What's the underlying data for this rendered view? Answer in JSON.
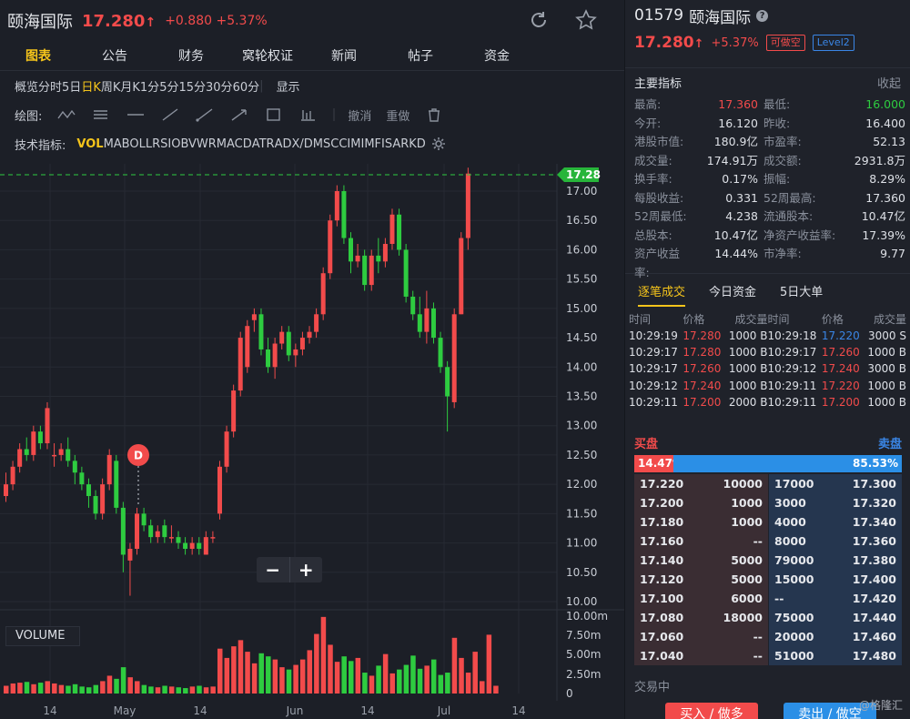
{
  "header": {
    "name": "颐海国际",
    "price": "17.280",
    "arrow": "↑",
    "change": "+0.880",
    "change_pct": "+5.37%"
  },
  "tabs": [
    "图表",
    "公告",
    "财务",
    "窝轮权证",
    "新闻",
    "帖子",
    "资金"
  ],
  "periods": [
    "概览",
    "分时",
    "5日",
    "日K",
    "周K",
    "月K",
    "1分",
    "5分",
    "15分",
    "30分",
    "60分"
  ],
  "display_label": "显示",
  "draw": {
    "label": "绘图:",
    "undo": "撤消",
    "redo": "重做"
  },
  "indicators_label": "技术指标:",
  "indicators": [
    "VOL",
    "MA",
    "BOLL",
    "RSI",
    "OBV",
    "WR",
    "MACD",
    "ATR",
    "ADX/DMS",
    "CCI",
    "MI",
    "MFI",
    "SAR",
    "KD"
  ],
  "volume_label": "VOLUME",
  "marker_label": "D",
  "chart_data": {
    "type": "candlestick",
    "last_price_tag": "17.28",
    "price_ticks": [
      "17.00",
      "16.50",
      "16.00",
      "15.50",
      "15.00",
      "14.50",
      "14.00",
      "13.50",
      "13.00",
      "12.50",
      "12.00",
      "11.50",
      "11.00",
      "10.50",
      "10.00"
    ],
    "volume_ticks": [
      "10.00m",
      "7.50m",
      "5.00m",
      "2.50m",
      "0"
    ],
    "x_ticks": [
      "14",
      "May",
      "14",
      "Jun",
      "14",
      "Jul",
      "14"
    ],
    "candles": [
      [
        11.8,
        12.0,
        12.2,
        11.7
      ],
      [
        12.0,
        12.3,
        12.4,
        11.9
      ],
      [
        12.3,
        12.6,
        12.7,
        12.2
      ],
      [
        12.6,
        12.5,
        12.8,
        12.4
      ],
      [
        12.5,
        12.9,
        13.0,
        12.4
      ],
      [
        12.9,
        12.7,
        13.0,
        12.6
      ],
      [
        12.7,
        13.3,
        13.4,
        12.6
      ],
      [
        12.5,
        12.5,
        12.7,
        12.3
      ],
      [
        12.5,
        12.6,
        12.7,
        12.4
      ],
      [
        12.6,
        12.4,
        12.8,
        12.3
      ],
      [
        12.4,
        12.2,
        12.5,
        12.0
      ],
      [
        12.2,
        12.0,
        12.3,
        11.9
      ],
      [
        12.0,
        11.8,
        12.1,
        11.6
      ],
      [
        11.8,
        11.5,
        11.9,
        11.4
      ],
      [
        11.5,
        12.0,
        12.1,
        11.4
      ],
      [
        12.0,
        12.5,
        12.6,
        11.9
      ],
      [
        12.4,
        11.6,
        12.5,
        11.5
      ],
      [
        11.6,
        10.8,
        11.7,
        10.5
      ],
      [
        10.7,
        10.9,
        11.0,
        10.1
      ],
      [
        10.9,
        11.5,
        11.6,
        10.8
      ],
      [
        11.5,
        11.3,
        11.6,
        11.2
      ],
      [
        11.3,
        11.1,
        11.4,
        11.0
      ],
      [
        11.1,
        11.2,
        11.3,
        11.0
      ],
      [
        11.3,
        11.1,
        11.4,
        11.0
      ],
      [
        11.1,
        11.1,
        11.3,
        11.0
      ],
      [
        11.1,
        11.0,
        11.2,
        10.9
      ],
      [
        11.0,
        10.9,
        11.1,
        10.8
      ],
      [
        10.9,
        11.0,
        11.1,
        10.8
      ],
      [
        11.0,
        10.9,
        11.1,
        10.8
      ],
      [
        10.8,
        11.1,
        11.2,
        10.8
      ],
      [
        11.1,
        11.1,
        11.2,
        11.0
      ],
      [
        11.5,
        12.3,
        12.4,
        11.4
      ],
      [
        12.3,
        12.9,
        13.0,
        12.2
      ],
      [
        12.9,
        13.6,
        13.7,
        12.8
      ],
      [
        13.6,
        14.5,
        14.6,
        13.5
      ],
      [
        14.0,
        14.7,
        14.8,
        13.9
      ],
      [
        14.8,
        14.9,
        15.0,
        14.6
      ],
      [
        14.9,
        14.3,
        15.0,
        14.2
      ],
      [
        14.3,
        14.0,
        14.5,
        13.9
      ],
      [
        14.0,
        14.4,
        14.5,
        13.8
      ],
      [
        14.4,
        14.6,
        14.7,
        14.3
      ],
      [
        14.6,
        14.2,
        14.7,
        14.1
      ],
      [
        14.2,
        14.3,
        14.4,
        14.0
      ],
      [
        14.3,
        14.5,
        14.6,
        14.2
      ],
      [
        14.5,
        14.6,
        14.7,
        14.4
      ],
      [
        14.6,
        14.9,
        15.0,
        14.5
      ],
      [
        14.9,
        15.6,
        15.7,
        14.8
      ],
      [
        15.6,
        16.5,
        16.6,
        15.5
      ],
      [
        16.5,
        17.0,
        17.1,
        16.4
      ],
      [
        17.0,
        16.2,
        17.1,
        16.1
      ],
      [
        16.2,
        15.8,
        16.3,
        15.6
      ],
      [
        15.8,
        15.9,
        16.1,
        15.7
      ],
      [
        15.9,
        15.4,
        16.0,
        15.3
      ],
      [
        15.4,
        15.9,
        16.0,
        15.3
      ],
      [
        15.9,
        15.8,
        16.2,
        15.6
      ],
      [
        15.8,
        16.1,
        16.2,
        15.7
      ],
      [
        16.1,
        16.6,
        16.7,
        16.0
      ],
      [
        16.6,
        16.0,
        16.7,
        15.9
      ],
      [
        16.0,
        15.2,
        16.1,
        15.1
      ],
      [
        15.2,
        14.9,
        15.3,
        14.8
      ],
      [
        14.9,
        14.6,
        15.2,
        14.5
      ],
      [
        14.6,
        15.0,
        15.3,
        14.4
      ],
      [
        15.0,
        14.5,
        15.1,
        14.4
      ],
      [
        14.5,
        14.0,
        14.6,
        13.9
      ],
      [
        14.0,
        13.5,
        14.1,
        12.9
      ],
      [
        13.4,
        14.9,
        15.0,
        13.3
      ],
      [
        14.9,
        16.2,
        16.3,
        14.9
      ],
      [
        16.2,
        17.3,
        17.4,
        16.0
      ]
    ],
    "volumes": [
      1.0,
      1.3,
      1.4,
      1.5,
      1.2,
      1.4,
      1.6,
      1.3,
      1.1,
      1.0,
      1.2,
      0.9,
      0.8,
      1.1,
      1.6,
      2.3,
      1.9,
      3.4,
      2.1,
      1.6,
      1.1,
      0.9,
      0.8,
      1.0,
      0.9,
      0.8,
      0.7,
      0.9,
      1.0,
      0.8,
      0.9,
      5.8,
      4.6,
      6.1,
      6.9,
      5.4,
      3.9,
      5.2,
      4.8,
      4.4,
      3.4,
      3.1,
      3.7,
      4.4,
      5.6,
      7.7,
      9.9,
      6.3,
      4.1,
      4.8,
      4.2,
      4.6,
      2.7,
      2.3,
      3.6,
      5.1,
      2.6,
      3.1,
      3.7,
      4.9,
      3.2,
      3.6,
      4.4,
      2.4,
      2.7,
      7.2,
      4.6,
      2.7,
      5.4,
      1.6,
      7.6,
      1.0
    ]
  },
  "right": {
    "code": "01579",
    "name": "颐海国际",
    "price": "17.280",
    "arrow": "↑",
    "change_pct": "+5.37%",
    "badge_short": "可做空",
    "badge_level": "Level2",
    "metrics_title": "主要指标",
    "metrics_collapse": "收起",
    "metrics": [
      {
        "k": "最高:",
        "v": "17.360",
        "k2": "最低:",
        "v2": "16.000"
      },
      {
        "k": "今开:",
        "v": "16.120",
        "k2": "昨收:",
        "v2": "16.400"
      },
      {
        "k": "港股市值:",
        "v": "180.9亿",
        "k2": "市盈率:",
        "v2": "52.13"
      },
      {
        "k": "成交量:",
        "v": "174.91万",
        "k2": "成交额:",
        "v2": "2931.8万"
      },
      {
        "k": "换手率:",
        "v": "0.17%",
        "k2": "振幅:",
        "v2": "8.29%"
      },
      {
        "k": "每股收益:",
        "v": "0.331",
        "k2": "52周最高:",
        "v2": "17.360"
      },
      {
        "k": "52周最低:",
        "v": "4.238",
        "k2": "流通股本:",
        "v2": "10.47亿"
      },
      {
        "k": "总股本:",
        "v": "10.47亿",
        "k2": "净资产收益率:",
        "v2": "17.39%"
      },
      {
        "k": "资产收益率:",
        "v": "14.44%",
        "k2": "市净率:",
        "v2": "9.77"
      }
    ],
    "trade_tabs": [
      "逐笔成交",
      "今日资金",
      "5日大单"
    ],
    "trade_headers": [
      "时间",
      "价格",
      "成交量",
      "时间",
      "价格",
      "成交量"
    ],
    "trades": [
      [
        "10:29:19",
        "17.280",
        "1000 B",
        "10:29:18",
        "17.220",
        "3000 S"
      ],
      [
        "10:29:17",
        "17.280",
        "1000 B",
        "10:29:17",
        "17.260",
        "1000 B"
      ],
      [
        "10:29:17",
        "17.260",
        "1000 B",
        "10:29:12",
        "17.240",
        "3000 B"
      ],
      [
        "10:29:12",
        "17.240",
        "1000 B",
        "10:29:11",
        "17.220",
        "1000 B"
      ],
      [
        "10:29:11",
        "17.200",
        "2000 B",
        "10:29:11",
        "17.200",
        "1000 B"
      ]
    ],
    "book_buy": "买盘",
    "book_sell": "卖盘",
    "buy_ratio": "14.47%",
    "sell_ratio": "85.53%",
    "bids": [
      [
        "17.220",
        "10000"
      ],
      [
        "17.200",
        "1000"
      ],
      [
        "17.180",
        "1000"
      ],
      [
        "17.160",
        "--"
      ],
      [
        "17.140",
        "5000"
      ],
      [
        "17.120",
        "5000"
      ],
      [
        "17.100",
        "6000"
      ],
      [
        "17.080",
        "18000"
      ],
      [
        "17.060",
        "--"
      ],
      [
        "17.040",
        "--"
      ]
    ],
    "asks": [
      [
        "17000",
        "17.300"
      ],
      [
        "3000",
        "17.320"
      ],
      [
        "4000",
        "17.340"
      ],
      [
        "8000",
        "17.360"
      ],
      [
        "79000",
        "17.380"
      ],
      [
        "15000",
        "17.400"
      ],
      [
        "--",
        "17.420"
      ],
      [
        "75000",
        "17.440"
      ],
      [
        "20000",
        "17.460"
      ],
      [
        "51000",
        "17.480"
      ]
    ],
    "status": "交易中",
    "buy_button": "买入 / 做多",
    "sell_button": "卖出 / 做空",
    "watermark": "@格隆汇"
  },
  "colors": {
    "up": "#f24b4b",
    "down": "#2ecc40",
    "accent": "#f5c41b",
    "blue": "#2b8fe6"
  }
}
